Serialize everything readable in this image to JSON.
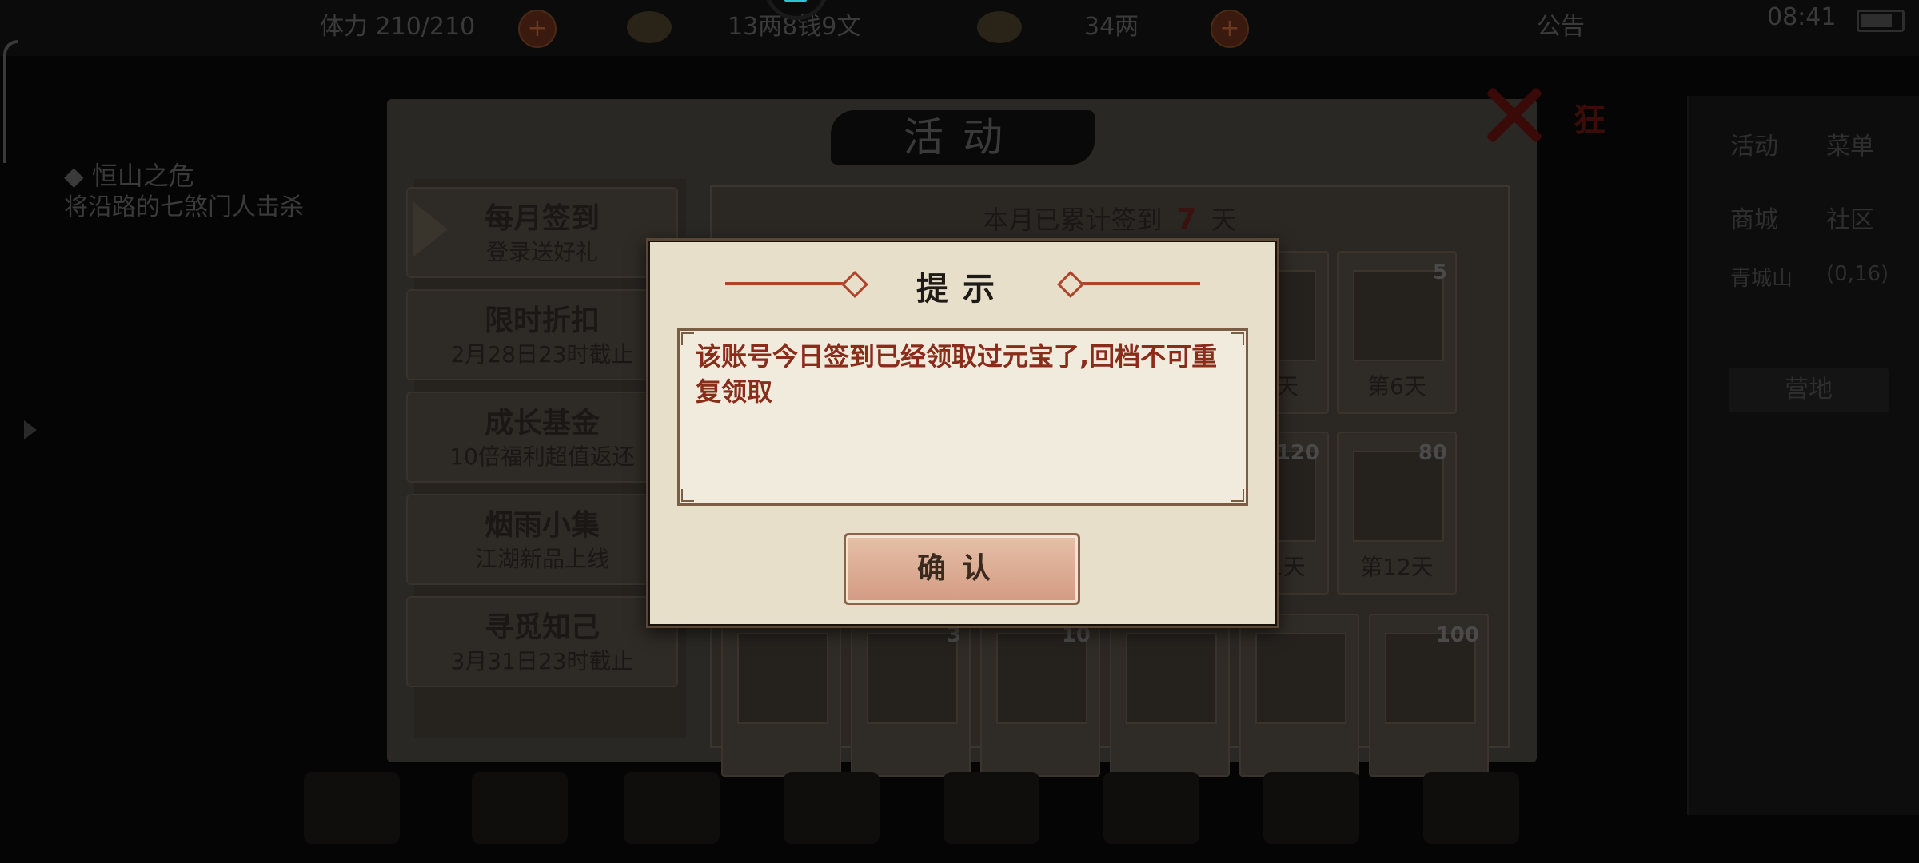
{
  "topbar": {
    "stamina": "体力 210/210",
    "silver": "13两8钱9文",
    "gold": "34两",
    "notice": "公告",
    "time": "08:41"
  },
  "quest": {
    "title": "◆ 恒山之危",
    "desc": "将沿路的七煞门人击杀"
  },
  "right_panel": {
    "activity": "活动",
    "menu": "菜单",
    "shop": "商城",
    "community": "社区",
    "location": "青城山",
    "coords": "(0,16)",
    "button": "营地"
  },
  "window": {
    "title": "活动",
    "wild_label": "狂"
  },
  "tabs": [
    {
      "title": "每月签到",
      "subtitle": "登录送好礼"
    },
    {
      "title": "限时折扣",
      "subtitle": "2月28日23时截止"
    },
    {
      "title": "成长基金",
      "subtitle": "10倍福利超值返还"
    },
    {
      "title": "烟雨小集",
      "subtitle": "江湖新品上线"
    },
    {
      "title": "寻觅知己",
      "subtitle": "3月31日23时截止"
    }
  ],
  "calendar": {
    "prefix": "本月已累计签到",
    "days": "7",
    "suffix": "天",
    "items": [
      {
        "label": "第5天",
        "count": ""
      },
      {
        "label": "第6天",
        "count": "5"
      },
      {
        "label": "第11天",
        "count": "120"
      },
      {
        "label": "第12天",
        "count": "80"
      },
      {
        "label": "",
        "count": ""
      },
      {
        "label": "",
        "count": "3"
      },
      {
        "label": "",
        "count": "10"
      },
      {
        "label": "",
        "count": ""
      },
      {
        "label": "",
        "count": ""
      },
      {
        "label": "",
        "count": "100"
      }
    ]
  },
  "dialog": {
    "title": "提示",
    "message": "该账号今日签到已经领取过元宝了,回档不可重复领取",
    "confirm": "确认"
  },
  "colors": {
    "dialog_bg": "#e8dfcb",
    "message_text": "#8a2c1a",
    "ornament": "#b0442a",
    "confirm_button": "#d49a82"
  }
}
